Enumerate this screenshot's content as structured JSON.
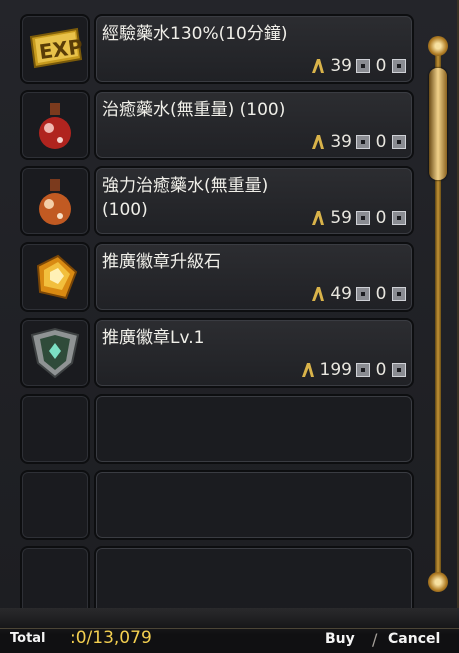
{
  "items": [
    {
      "name": "經驗藥水130%(10分鐘)",
      "price": "39",
      "qty": "0",
      "icon": "exp-potion-icon"
    },
    {
      "name": "治癒藥水(無重量) (100)",
      "price": "39",
      "qty": "0",
      "icon": "red-potion-icon"
    },
    {
      "name": "強力治癒藥水(無重量)\n (100)",
      "price": "59",
      "qty": "0",
      "icon": "orange-potion-icon"
    },
    {
      "name": "推廣徽章升級石",
      "price": "49",
      "qty": "0",
      "icon": "gem-stone-icon"
    },
    {
      "name": "推廣徽章Lv.1",
      "price": "199",
      "qty": "0",
      "icon": "shield-badge-icon"
    }
  ],
  "empty_slots": 3,
  "footer": {
    "total_label": "Total",
    "total_value": ":0/13,079",
    "buy_label": "Buy",
    "cancel_label": "Cancel"
  },
  "colors": {
    "gold": "#f3cf50",
    "panel": "#24252a"
  }
}
